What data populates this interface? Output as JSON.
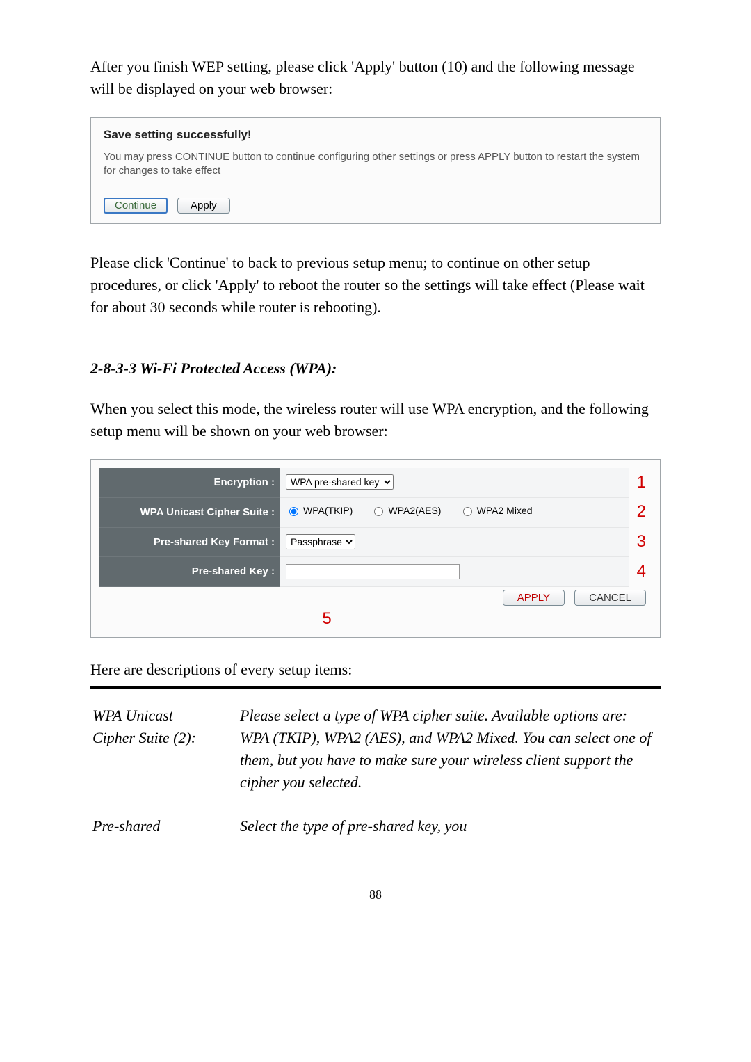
{
  "para1": "After you finish WEP setting, please click 'Apply' button (10) and the following message will be displayed on your web browser:",
  "shot1": {
    "title": "Save setting successfully!",
    "desc": "You may press CONTINUE button to continue configuring other settings or press APPLY button to restart the system for changes to take effect",
    "continue_label": "Continue",
    "apply_label": "Apply"
  },
  "para2": "Please click 'Continue' to back to previous setup menu; to continue on other setup procedures, or click 'Apply' to reboot the router so the settings will take effect (Please wait for about 30 seconds while router is rebooting).",
  "subheading": "2-8-3-3 Wi-Fi Protected Access (WPA):",
  "para3": "When you select this mode, the wireless router will use WPA encryption, and the following setup menu will be shown on your web browser:",
  "shot2": {
    "labels": {
      "encryption": "Encryption :",
      "cipher": "WPA Unicast Cipher Suite :",
      "format": "Pre-shared Key Format :",
      "key": "Pre-shared Key :"
    },
    "encryption_value": "WPA pre-shared key",
    "cipher_options": {
      "wpa_tkip": "WPA(TKIP)",
      "wpa2_aes": "WPA2(AES)",
      "wpa2_mixed": "WPA2 Mixed"
    },
    "format_value": "Passphrase",
    "key_value": "",
    "apply_label": "APPLY",
    "cancel_label": "CANCEL",
    "callouts": {
      "c1": "1",
      "c2": "2",
      "c3": "3",
      "c4": "4",
      "c5": "5"
    }
  },
  "desc_intro": "Here are descriptions of every setup items:",
  "defs": {
    "t1a": "WPA Unicast",
    "t1b": "Cipher Suite (2):",
    "d1": "Please select a type of WPA cipher suite. Available options are: WPA (TKIP), WPA2 (AES), and WPA2 Mixed. You can select one of them, but you have to make sure your wireless client support the cipher you selected.",
    "t2": "Pre-shared",
    "d2": "Select the type of pre-shared key, you"
  },
  "page_number": "88"
}
